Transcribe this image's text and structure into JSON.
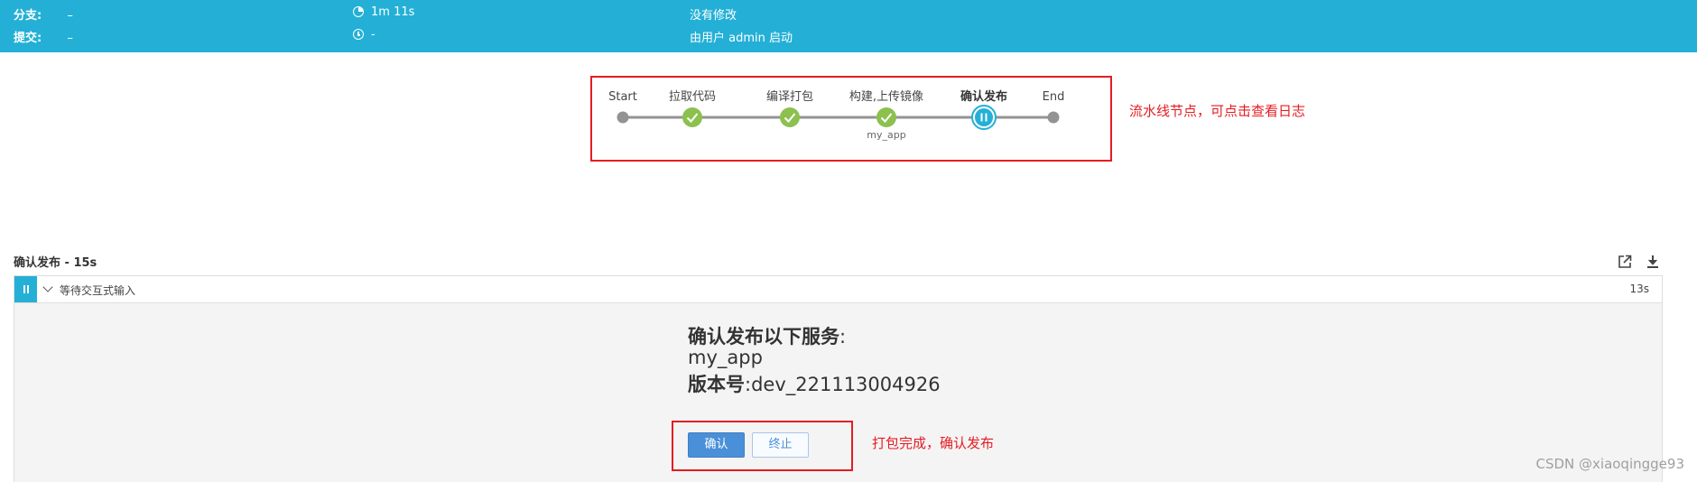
{
  "topbar": {
    "branch_label": "分支:",
    "branch_value": "–",
    "commit_label": "提交:",
    "commit_value": "–",
    "duration": "1m 11s",
    "started_ago": "-",
    "changes": "没有修改",
    "started_by": "由用户 admin 启动"
  },
  "pipeline": {
    "stages": [
      {
        "label": "Start",
        "status": "node"
      },
      {
        "label": "拉取代码",
        "status": "success"
      },
      {
        "label": "编译打包",
        "status": "success"
      },
      {
        "label": "构建,上传镜像",
        "status": "success",
        "sub": "my_app"
      },
      {
        "label": "确认发布",
        "status": "paused"
      },
      {
        "label": "End",
        "status": "node"
      }
    ],
    "annotation": "流水线节点，可点击查看日志"
  },
  "step": {
    "title": "确认发布 - 15s",
    "row_label": "等待交互式输入",
    "row_duration": "13s"
  },
  "input": {
    "line1": "确认发布以下服务",
    "line1_suffix": ":",
    "line2": "my_app",
    "line3_label": "版本号",
    "line3_value": ":dev_221113004926",
    "confirm_label": "确认",
    "abort_label": "终止",
    "annotation": "打包完成，确认发布"
  },
  "watermark": "CSDN @xiaoqingge93",
  "colors": {
    "header": "#24b0d6",
    "success": "#8cc04f",
    "paused": "#24b0d6",
    "annotation": "#e51c23",
    "primary": "#4a90d9"
  }
}
